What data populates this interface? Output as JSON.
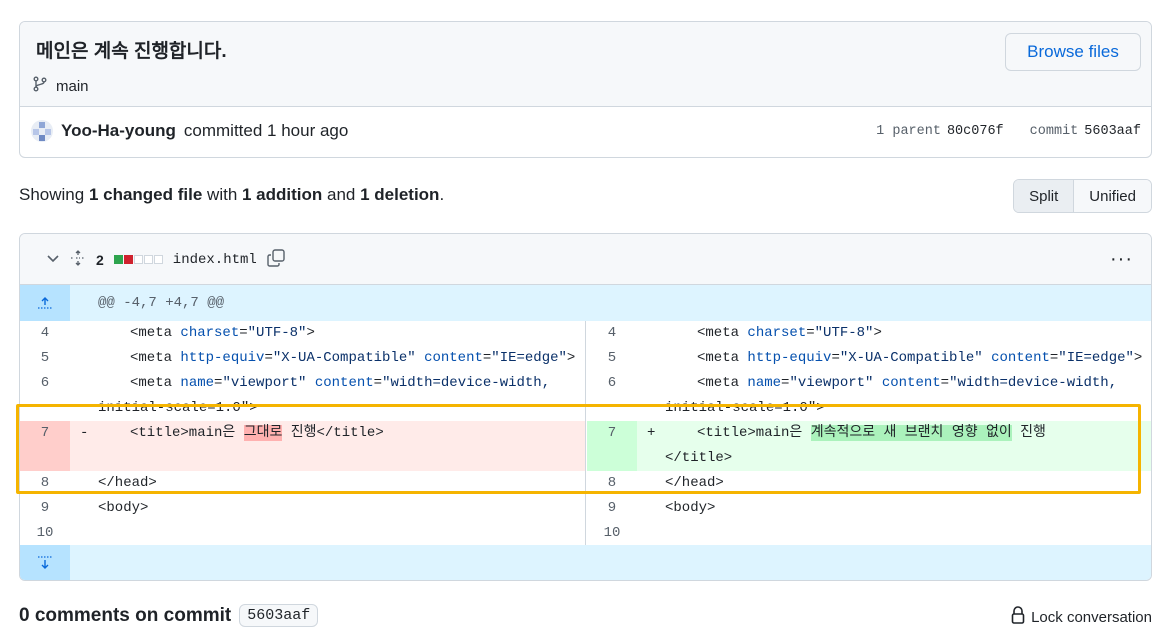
{
  "commit": {
    "title": "메인은 계속 진행합니다.",
    "branch": "main",
    "browse_label": "Browse files",
    "author": "Yoo-Ha-young",
    "committed_text": "committed 1 hour ago",
    "parent_label": "1 parent",
    "parent_sha": "80c076f",
    "commit_label": "commit",
    "commit_sha": "5603aaf"
  },
  "summary": {
    "prefix": "Showing ",
    "changed": "1 changed file",
    "with": " with ",
    "additions": "1 addition",
    "and": " and ",
    "deletions": "1 deletion",
    "suffix": "."
  },
  "view_toggle": {
    "split": "Split",
    "unified": "Unified"
  },
  "file": {
    "change_count": "2",
    "name": "index.html",
    "hunk_header": "@@ -4,7 +4,7 @@",
    "colors": {
      "add": "#2da44e",
      "del": "#cf222e",
      "neutral": "#d0d7de"
    }
  },
  "diff": {
    "left": [
      {
        "num": "4",
        "tag1": "<meta ",
        "attr1": "charset",
        "eq1": "=",
        "val1": "\"UTF-8\"",
        "rest": ">"
      },
      {
        "num": "5",
        "tag1": "<meta ",
        "attr1": "http-equiv",
        "eq1": "=",
        "val1": "\"X-UA-Compatible\"",
        "attr2": " content",
        "eq2": "=",
        "val2": "\"IE=edge\"",
        "rest": ">"
      },
      {
        "num": "6",
        "tag1": "<meta ",
        "attr1": "name",
        "eq1": "=",
        "val1": "\"viewport\"",
        "attr2": " content",
        "eq2": "=",
        "val2": "\"width=device-width,",
        "cont": "initial-scale=1.0\">"
      },
      {
        "num": "7",
        "sign": "-",
        "pre": "<title>main은 ",
        "hl": "그대로",
        "post": " 진행</title>"
      },
      {
        "num": "8",
        "code": "</head>"
      },
      {
        "num": "9",
        "code": "<body>"
      },
      {
        "num": "10",
        "code": ""
      }
    ],
    "right": [
      {
        "num": "4"
      },
      {
        "num": "5"
      },
      {
        "num": "6"
      },
      {
        "num": "7",
        "sign": "+",
        "pre": "<title>main은 ",
        "hl": "계속적으로 새 브랜치 영향 없이",
        "post": " 진행",
        "cont": "</title>"
      },
      {
        "num": "8",
        "code": "</head>"
      },
      {
        "num": "9",
        "code": "<body>"
      },
      {
        "num": "10",
        "code": ""
      }
    ]
  },
  "comments": {
    "title": "0 comments on commit",
    "sha": "5603aaf",
    "lock_label": "Lock conversation"
  }
}
